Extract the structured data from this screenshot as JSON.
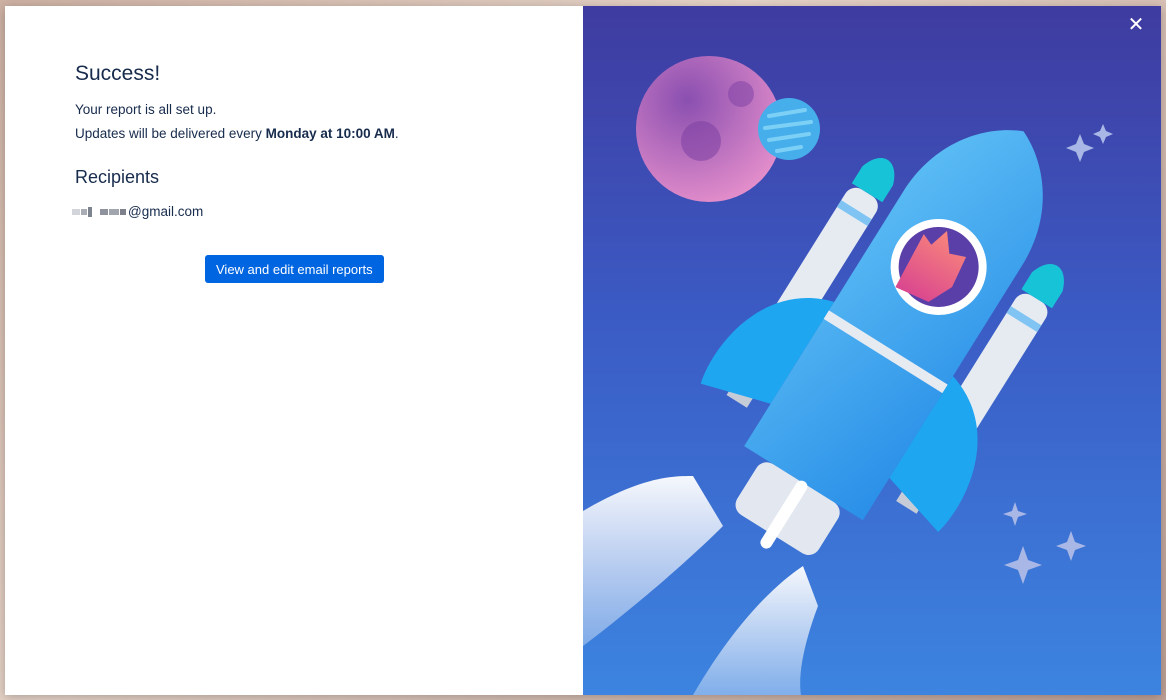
{
  "dialog": {
    "title": "Success!",
    "message_line1": "Your report is all set up.",
    "message_line2_prefix": "Updates will be delivered every ",
    "schedule": "Monday at 10:00 AM",
    "message_line2_suffix": ".",
    "recipients_title": "Recipients",
    "recipient_email_suffix": "@gmail.com",
    "action_button_label": "View and edit email reports",
    "close_icon": "close-icon"
  },
  "colors": {
    "primary_button": "#0065e1",
    "text": "#172b4d",
    "illustration_bg_top": "#3f3ba0",
    "illustration_bg_bottom": "#3c84e0"
  }
}
